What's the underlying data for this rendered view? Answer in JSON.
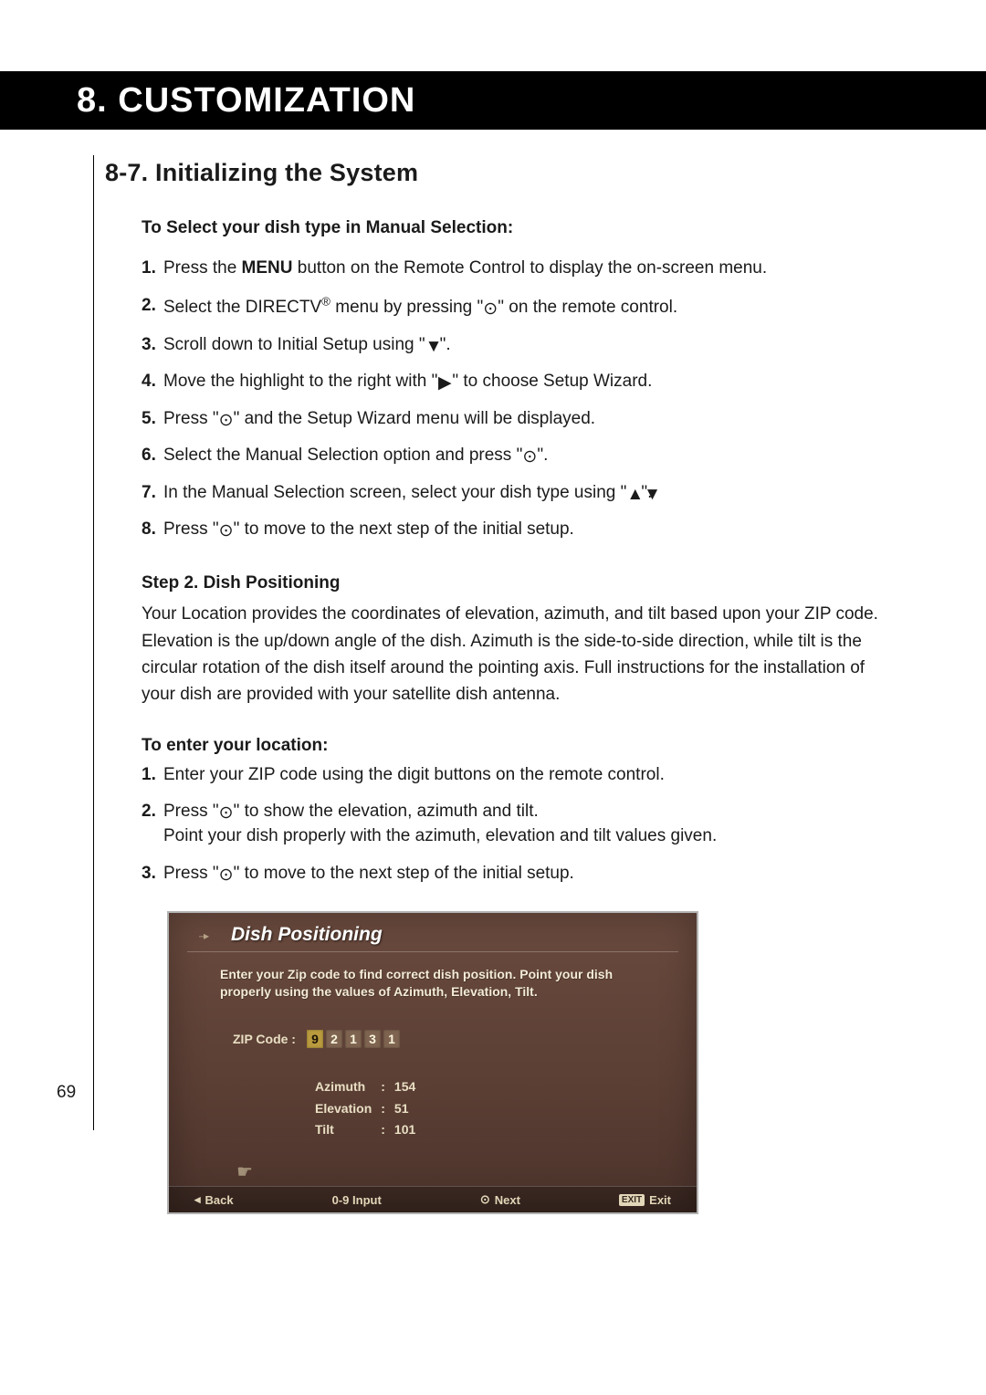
{
  "header": {
    "title": "8. CUSTOMIZATION"
  },
  "section_title": "8-7. Initializing the System",
  "manual_selection": {
    "heading": "To Select your dish type in Manual Selection:",
    "steps": [
      {
        "pre": "Press the ",
        "strong": "MENU",
        "post": " button on the Remote Control to display the on-screen menu."
      },
      {
        "pre": "Select the DIRECTV",
        "sup": "®",
        "mid": " menu by pressing \"",
        "icon": "select",
        "post": "\" on the remote control."
      },
      {
        "pre": "Scroll down to Initial Setup using \"",
        "icon": "down",
        "post": "\"."
      },
      {
        "pre": "Move the highlight to the right with \"",
        "icon": "right",
        "post": "\" to choose Setup Wizard."
      },
      {
        "pre": "Press \"",
        "icon": "select",
        "post": "\" and the Setup Wizard menu will be displayed."
      },
      {
        "pre": "Select the Manual Selection option and press \"",
        "icon": "select",
        "post": "\"."
      },
      {
        "pre": "In the Manual Selection screen, select your dish type using \"",
        "icon": "updown",
        "post": "\"."
      },
      {
        "pre": "Press \"",
        "icon": "select",
        "post": "\" to move to the next step of the initial setup."
      }
    ]
  },
  "dish_positioning": {
    "heading": "Step 2. Dish Positioning",
    "paragraph": "Your Location provides the coordinates of elevation, azimuth, and tilt based upon your ZIP code. Elevation is the up/down angle of the dish. Azimuth is the side-to-side direction, while tilt is the circular rotation of the dish itself around the pointing axis. Full instructions for the installation of your dish are provided with your satellite dish antenna."
  },
  "enter_location": {
    "heading": "To enter your location:",
    "steps": [
      {
        "pre": "Enter your ZIP code using the digit buttons on the remote control."
      },
      {
        "pre": "Press \"",
        "icon": "select",
        "post": "\" to show the elevation, azimuth and tilt.",
        "cont": "Point your dish properly with the azimuth, elevation and tilt values given."
      },
      {
        "pre": "Press \"",
        "icon": "select",
        "post": "\" to move to the next step of the initial setup."
      }
    ]
  },
  "tv": {
    "title": "Dish Positioning",
    "instruction": "Enter your Zip code to find correct dish position. Point your dish properly using the values of Azimuth, Elevation, Tilt.",
    "zip_label": "ZIP Code  :",
    "zip_digits": [
      "9",
      "2",
      "1",
      "3",
      "1"
    ],
    "values": {
      "Azimuth": "154",
      "Elevation": "51",
      "Tilt": "101"
    },
    "footer": {
      "back": "Back",
      "input": "0-9 Input",
      "next": "Next",
      "exit_badge": "EXIT",
      "exit": "Exit"
    }
  },
  "page_number": "69"
}
